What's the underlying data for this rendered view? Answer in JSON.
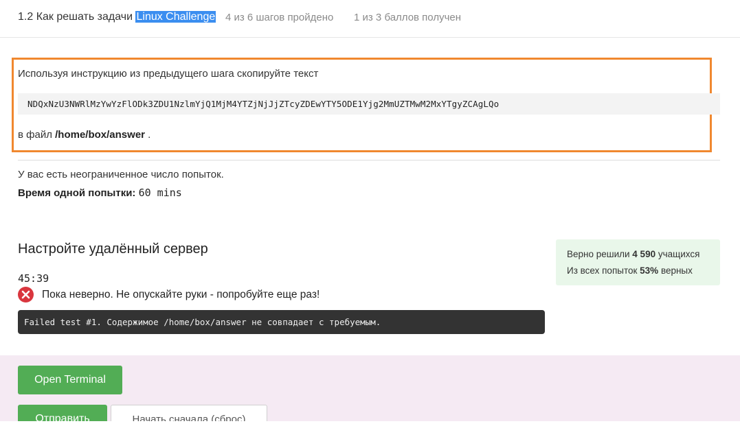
{
  "header": {
    "step_prefix": "1.2 Как решать задачи ",
    "step_highlight": "Linux Challenge",
    "steps_progress": "4 из 6 шагов пройдено",
    "score_progress": "1 из 3 баллов  получен"
  },
  "task": {
    "instruction": "Используя инструкцию из предыдущего шага скопируйте текст",
    "code": "NDQxNzU3NWRlMzYwYzFlODk3ZDU1NzlmYjQ1MjM4YTZjNjJjZTcyZDEwYTY5ODE1Yjg2MmUZTMwM2MxYTgyZCAgLQo",
    "file_prefix": "в файл ",
    "file_path": "/home/box/answer",
    "file_suffix": " ."
  },
  "attempts": {
    "unlimited_text": "У вас есть неограниченное число попыток.",
    "time_label": "Время одной попытки:",
    "time_value": "60 mins"
  },
  "server": {
    "title": "Настройте удалённый сервер",
    "timer": "45:39",
    "status_icon": "error-circle-icon",
    "status_message": "Пока неверно. Не опускайте руки - попробуйте еще раз!",
    "console_output": "Failed test #1. Содержимое /home/box/answer не совпадает с требуемым."
  },
  "stats": {
    "solved_prefix": "Верно решили ",
    "solved_count": "4 590",
    "solved_suffix": " учащихся",
    "rate_prefix": "Из всех попыток ",
    "rate_value": "53%",
    "rate_suffix": " верных"
  },
  "actions": {
    "open_terminal": "Open Terminal",
    "submit": "Отправить",
    "reset": "Начать сначала (сброс)"
  },
  "colors": {
    "accent_orange": "#f0882f",
    "highlight_blue": "#3b8ef0",
    "button_green": "#52ad55",
    "error_red": "#d9363e",
    "stats_bg": "#e9f7ea",
    "action_bg": "#f5eaf3"
  }
}
